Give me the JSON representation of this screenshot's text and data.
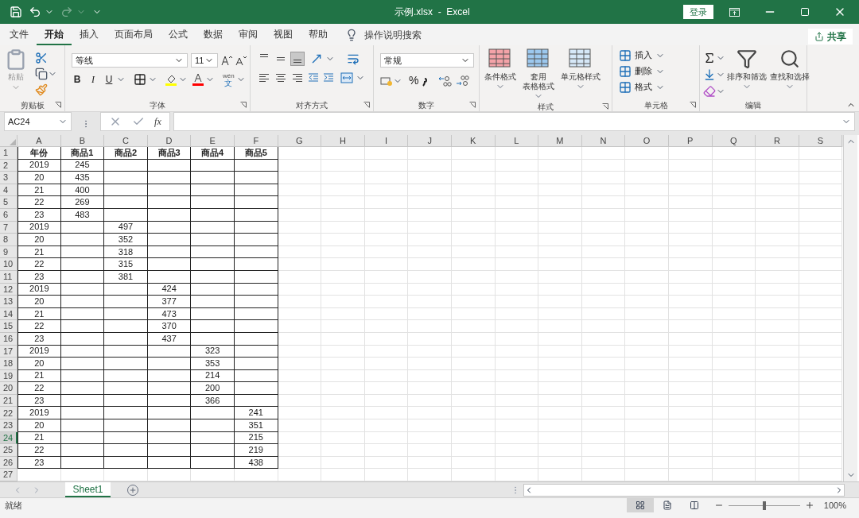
{
  "window": {
    "title": "示例.xlsx  -  Excel",
    "sign_in": "登录"
  },
  "menu_tabs": [
    {
      "label": "文件",
      "selected": false
    },
    {
      "label": "开始",
      "selected": true
    },
    {
      "label": "插入",
      "selected": false
    },
    {
      "label": "页面布局",
      "selected": false
    },
    {
      "label": "公式",
      "selected": false
    },
    {
      "label": "数据",
      "selected": false
    },
    {
      "label": "审阅",
      "selected": false
    },
    {
      "label": "视图",
      "selected": false
    },
    {
      "label": "帮助",
      "selected": false
    }
  ],
  "tell_me": "操作说明搜索",
  "share": "共享",
  "ribbon": {
    "clipboard": {
      "label": "剪贴板",
      "paste": "粘贴"
    },
    "font": {
      "label": "字体",
      "name": "等线",
      "size": "11",
      "bold": "B",
      "italic": "I",
      "underline": "U",
      "phonetic_top": "wén",
      "phonetic_bottom": "文"
    },
    "alignment": {
      "label": "对齐方式",
      "vertical": [
        {
          "kind": "top",
          "selected": false
        },
        {
          "kind": "middle",
          "selected": false
        },
        {
          "kind": "bottom",
          "selected": true
        }
      ],
      "horizontal": [
        {
          "kind": "left",
          "selected": false
        },
        {
          "kind": "center",
          "selected": false
        },
        {
          "kind": "right",
          "selected": false
        }
      ]
    },
    "number": {
      "label": "数字",
      "format": "常规",
      "percent": "%"
    },
    "styles": {
      "label": "样式",
      "buttons": [
        {
          "lines": [
            "条件格式"
          ]
        },
        {
          "lines": [
            "套用",
            "表格格式"
          ]
        },
        {
          "lines": [
            "单元格样式"
          ]
        }
      ]
    },
    "cells": {
      "label": "单元格",
      "buttons": [
        "插入",
        "删除",
        "格式"
      ]
    },
    "editing": {
      "label": "编辑",
      "buttons": [
        "排序和筛选",
        "查找和选择"
      ]
    }
  },
  "formula_bar": {
    "name_box": "AC24",
    "function_label": "fx"
  },
  "sheet": {
    "columns": [
      "A",
      "B",
      "C",
      "D",
      "E",
      "F",
      "G",
      "H",
      "I",
      "J",
      "K",
      "L",
      "M",
      "N",
      "O",
      "P",
      "Q",
      "R",
      "S"
    ],
    "rows": [
      {
        "number": "1",
        "selected": false,
        "header": true,
        "cells": [
          "年份",
          "商品1",
          "商品2",
          "商品3",
          "商品4",
          "商品5"
        ]
      },
      {
        "number": "2",
        "selected": false,
        "cells": [
          "2019",
          "245",
          null,
          null,
          null,
          null
        ]
      },
      {
        "number": "3",
        "selected": false,
        "cells": [
          "20",
          "435",
          null,
          null,
          null,
          null
        ]
      },
      {
        "number": "4",
        "selected": false,
        "cells": [
          "21",
          "400",
          null,
          null,
          null,
          null
        ]
      },
      {
        "number": "5",
        "selected": false,
        "cells": [
          "22",
          "269",
          null,
          null,
          null,
          null
        ]
      },
      {
        "number": "6",
        "selected": false,
        "cells": [
          "23",
          "483",
          null,
          null,
          null,
          null
        ]
      },
      {
        "number": "7",
        "selected": false,
        "cells": [
          "2019",
          null,
          "497",
          null,
          null,
          null
        ]
      },
      {
        "number": "8",
        "selected": false,
        "cells": [
          "20",
          null,
          "352",
          null,
          null,
          null
        ]
      },
      {
        "number": "9",
        "selected": false,
        "cells": [
          "21",
          null,
          "318",
          null,
          null,
          null
        ]
      },
      {
        "number": "10",
        "selected": false,
        "cells": [
          "22",
          null,
          "315",
          null,
          null,
          null
        ]
      },
      {
        "number": "11",
        "selected": false,
        "cells": [
          "23",
          null,
          "381",
          null,
          null,
          null
        ]
      },
      {
        "number": "12",
        "selected": false,
        "cells": [
          "2019",
          null,
          null,
          "424",
          null,
          null
        ]
      },
      {
        "number": "13",
        "selected": false,
        "cells": [
          "20",
          null,
          null,
          "377",
          null,
          null
        ]
      },
      {
        "number": "14",
        "selected": false,
        "cells": [
          "21",
          null,
          null,
          "473",
          null,
          null
        ]
      },
      {
        "number": "15",
        "selected": false,
        "cells": [
          "22",
          null,
          null,
          "370",
          null,
          null
        ]
      },
      {
        "number": "16",
        "selected": false,
        "cells": [
          "23",
          null,
          null,
          "437",
          null,
          null
        ]
      },
      {
        "number": "17",
        "selected": false,
        "cells": [
          "2019",
          null,
          null,
          null,
          "323",
          null
        ]
      },
      {
        "number": "18",
        "selected": false,
        "cells": [
          "20",
          null,
          null,
          null,
          "353",
          null
        ]
      },
      {
        "number": "19",
        "selected": false,
        "cells": [
          "21",
          null,
          null,
          null,
          "214",
          null
        ]
      },
      {
        "number": "20",
        "selected": false,
        "cells": [
          "22",
          null,
          null,
          null,
          "200",
          null
        ]
      },
      {
        "number": "21",
        "selected": false,
        "cells": [
          "23",
          null,
          null,
          null,
          "366",
          null
        ]
      },
      {
        "number": "22",
        "selected": false,
        "cells": [
          "2019",
          null,
          null,
          null,
          null,
          "241"
        ]
      },
      {
        "number": "23",
        "selected": false,
        "cells": [
          "20",
          null,
          null,
          null,
          null,
          "351"
        ]
      },
      {
        "number": "24",
        "selected": true,
        "cells": [
          "21",
          null,
          null,
          null,
          null,
          "215"
        ]
      },
      {
        "number": "25",
        "selected": false,
        "cells": [
          "22",
          null,
          null,
          null,
          null,
          "219"
        ]
      },
      {
        "number": "26",
        "selected": false,
        "cells": [
          "23",
          null,
          null,
          null,
          null,
          "438"
        ]
      },
      {
        "number": "27",
        "selected": false
      }
    ]
  },
  "sheet_tabs": [
    {
      "label": "Sheet1",
      "selected": true
    }
  ],
  "status_bar": {
    "status": "就绪",
    "views": [
      {
        "kind": "normal",
        "selected": true
      },
      {
        "kind": "page_layout",
        "selected": false
      },
      {
        "kind": "page_break",
        "selected": false
      }
    ],
    "zoom": {
      "level": 0.5
    },
    "zoom_text": "100%"
  }
}
